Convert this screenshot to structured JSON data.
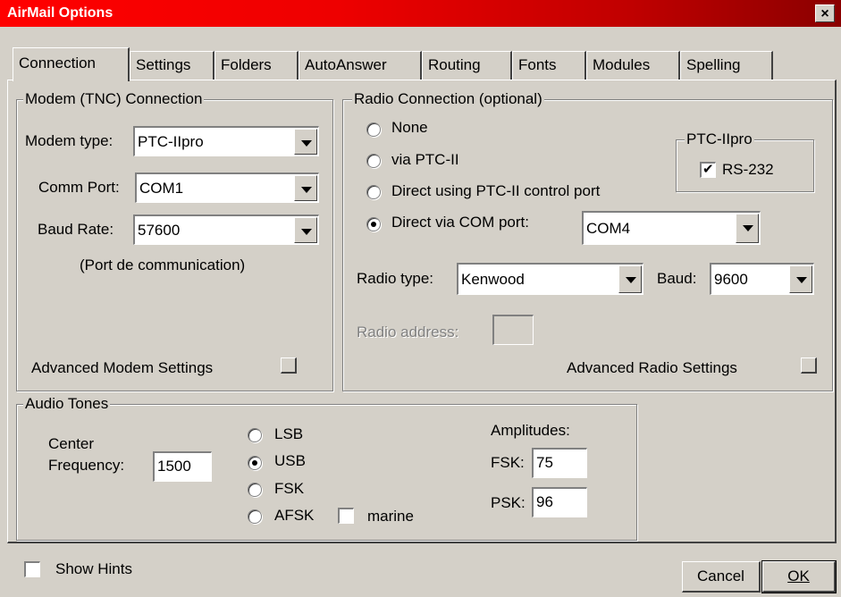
{
  "window": {
    "title": "AirMail Options",
    "close_glyph": "×"
  },
  "tabs": [
    "Connection",
    "Settings",
    "Folders",
    "AutoAnswer",
    "Routing",
    "Fonts",
    "Modules",
    "Spelling"
  ],
  "modem": {
    "group_title": "Modem (TNC) Connection",
    "modem_type_label": "Modem type:",
    "modem_type_value": "PTC-IIpro",
    "comm_port_label": "Comm Port:",
    "comm_port_value": "COM1",
    "baud_rate_label": "Baud Rate:",
    "baud_rate_value": "57600",
    "port_note": "(Port de communication)",
    "advanced_label": "Advanced Modem Settings"
  },
  "radio": {
    "group_title": "Radio Connection (optional)",
    "options": [
      "None",
      "via PTC-II",
      "Direct using PTC-II control port",
      "Direct via COM port:"
    ],
    "selected_option": "Direct via COM port:",
    "com_port_value": "COM4",
    "ptc_group_title": "PTC-IIpro",
    "rs232_label": "RS-232",
    "rs232_checked": true,
    "radio_type_label": "Radio type:",
    "radio_type_value": "Kenwood",
    "baud_label": "Baud:",
    "baud_value": "9600",
    "radio_address_label": "Radio address:",
    "advanced_label": "Advanced Radio Settings"
  },
  "audio": {
    "group_title": "Audio Tones",
    "center_label_1": "Center",
    "center_label_2": "Frequency:",
    "center_value": "1500",
    "modes": [
      "LSB",
      "USB",
      "FSK",
      "AFSK"
    ],
    "selected_mode": "USB",
    "marine_label": "marine",
    "marine_checked": false,
    "amplitudes_label": "Amplitudes:",
    "fsk_label": "FSK:",
    "fsk_value": "75",
    "psk_label": "PSK:",
    "psk_value": "96"
  },
  "footer": {
    "show_hints_label": "Show Hints",
    "cancel_label": "Cancel",
    "ok_label": "OK"
  },
  "colors": {
    "title_start": "#ff0000",
    "title_end": "#8a0000",
    "face": "#d4d0c8"
  }
}
